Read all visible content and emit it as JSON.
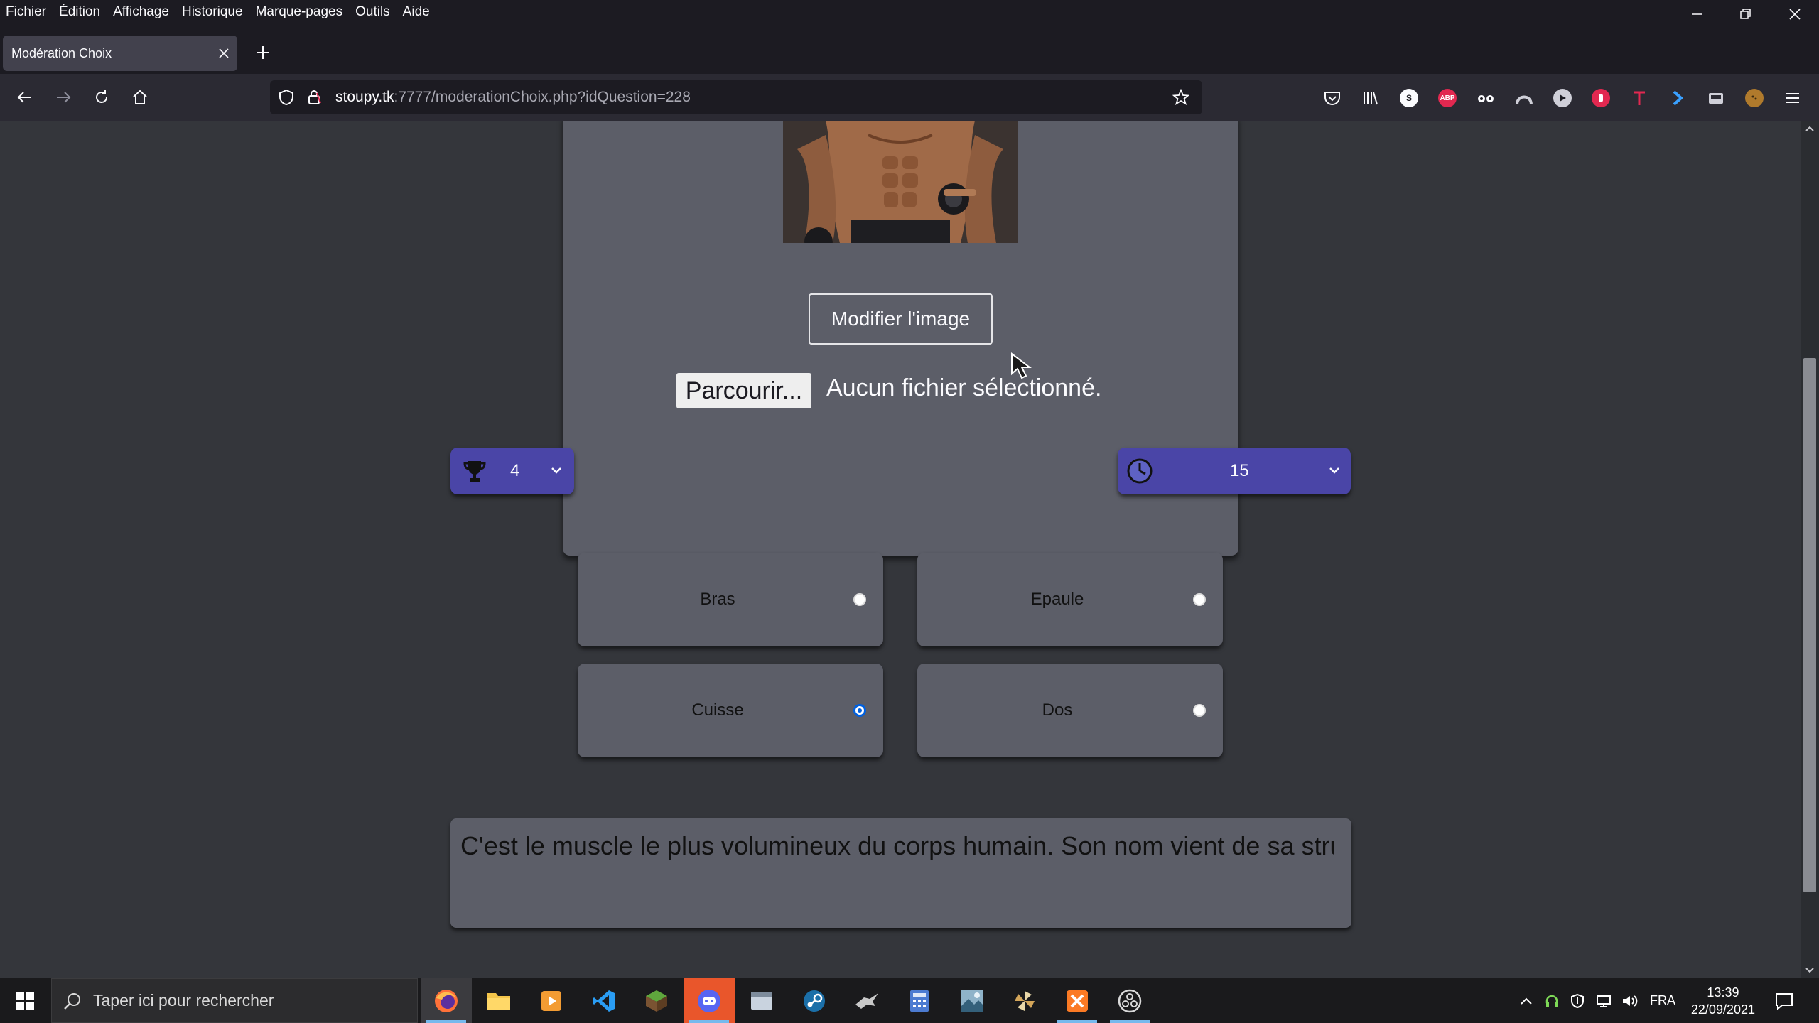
{
  "menubar": {
    "items": [
      "Fichier",
      "Édition",
      "Affichage",
      "Historique",
      "Marque-pages",
      "Outils",
      "Aide"
    ]
  },
  "tab": {
    "title": "Modération Choix"
  },
  "urlbar": {
    "host": "stoupy.tk",
    "rest": ":7777/moderationChoix.php?idQuestion=228"
  },
  "extensions": {
    "s_badge": "S",
    "abp_badge": "ABP"
  },
  "card": {
    "modify_image_label": "Modifier l'image",
    "browse_label": "Parcourir...",
    "file_status": "Aucun fichier sélectionné."
  },
  "points_select": {
    "value": "4",
    "icon": "trophy-icon"
  },
  "time_select": {
    "value": "15",
    "icon": "clock-icon"
  },
  "choices": [
    {
      "label": "Bras",
      "checked": false
    },
    {
      "label": "Epaule",
      "checked": false
    },
    {
      "label": "Cuisse",
      "checked": true
    },
    {
      "label": "Dos",
      "checked": false
    }
  ],
  "explanation": {
    "text": "C'est le muscle le plus volumineux du corps humain. Son nom vient de sa struc"
  },
  "taskbar": {
    "search_placeholder": "Taper ici pour rechercher",
    "language": "FRA",
    "time": "13:39",
    "date": "22/09/2021"
  },
  "colors": {
    "accent_select": "#4a45a7",
    "card": "#5c5e68",
    "page_bg": "#34363b",
    "radio_checked": "#0060df"
  }
}
